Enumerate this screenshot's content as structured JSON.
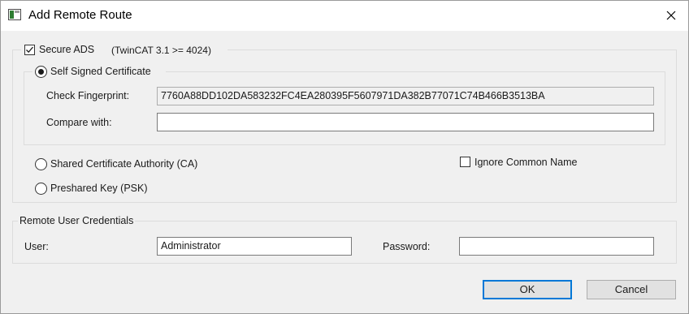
{
  "window": {
    "title": "Add Remote Route"
  },
  "secure_ads": {
    "checkbox_label": "Secure ADS",
    "note": "(TwinCAT 3.1 >= 4024)",
    "checked": true
  },
  "self_signed": {
    "label": "Self Signed Certificate",
    "selected": true,
    "check_fingerprint_label": "Check Fingerprint:",
    "check_fingerprint_value": "7760A88DD102DA583232FC4EA280395F5607971DA382B77071C74B466B3513BA",
    "compare_with_label": "Compare with:",
    "compare_with_value": ""
  },
  "shared_ca": {
    "label": "Shared Certificate Authority (CA)",
    "selected": false
  },
  "ignore_common_name": {
    "label": "Ignore Common Name",
    "checked": false
  },
  "psk": {
    "label": "Preshared Key (PSK)",
    "selected": false
  },
  "credentials": {
    "group_label": "Remote User Credentials",
    "user_label": "User:",
    "user_value": "Administrator",
    "password_label": "Password:",
    "password_value": ""
  },
  "buttons": {
    "ok": "OK",
    "cancel": "Cancel"
  },
  "colors": {
    "accent": "#0078d7",
    "background": "#f0f0f0"
  }
}
